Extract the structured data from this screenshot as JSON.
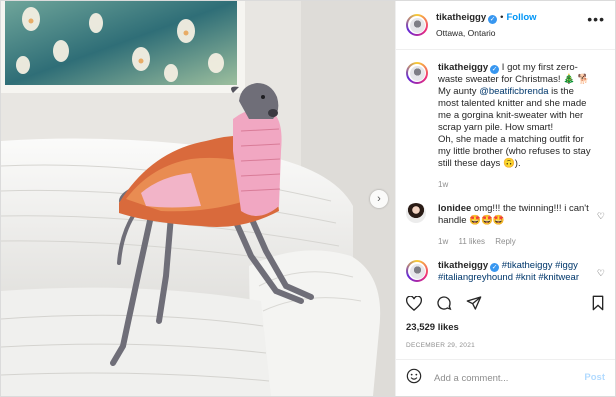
{
  "post": {
    "username": "tikatheiggy",
    "follow_label": "Follow",
    "location": "Ottawa, Ontario",
    "more_label": "•••",
    "caption_username": "tikatheiggy",
    "caption_lines": [
      "I got my first zero-waste sweater for Christmas! 🎄 🐕",
      "My aunty ",
      "@beatificbrenda",
      " is the most talented knitter and she made me a gorgina knit-sweater with her scrap yarn pile. How smart!",
      "Oh, she made a matching outfit for my little brother (who refuses to stay still these days 🙃)."
    ],
    "caption_time": "1w",
    "comments": [
      {
        "username": "lonidee",
        "text": "omg!!! the twinning!!! i can't handle 🤩🤩🤩",
        "time": "1w",
        "likes": "11 likes",
        "reply": "Reply"
      },
      {
        "username": "tikatheiggy",
        "text": "#tikatheiggy #iggy #italiangreyhound #knit #knitwear"
      }
    ],
    "likes_count": "23,529 likes",
    "date": "DECEMBER 29, 2021",
    "add_comment_placeholder": "Add a comment...",
    "post_button": "Post"
  },
  "colors": {
    "accent": "#0095f6",
    "verified": "#3897f0"
  },
  "icons": [
    "verified-badge-icon",
    "more-icon",
    "heart-icon",
    "comment-icon",
    "share-icon",
    "bookmark-icon",
    "emoji-icon",
    "carousel-next-icon"
  ]
}
